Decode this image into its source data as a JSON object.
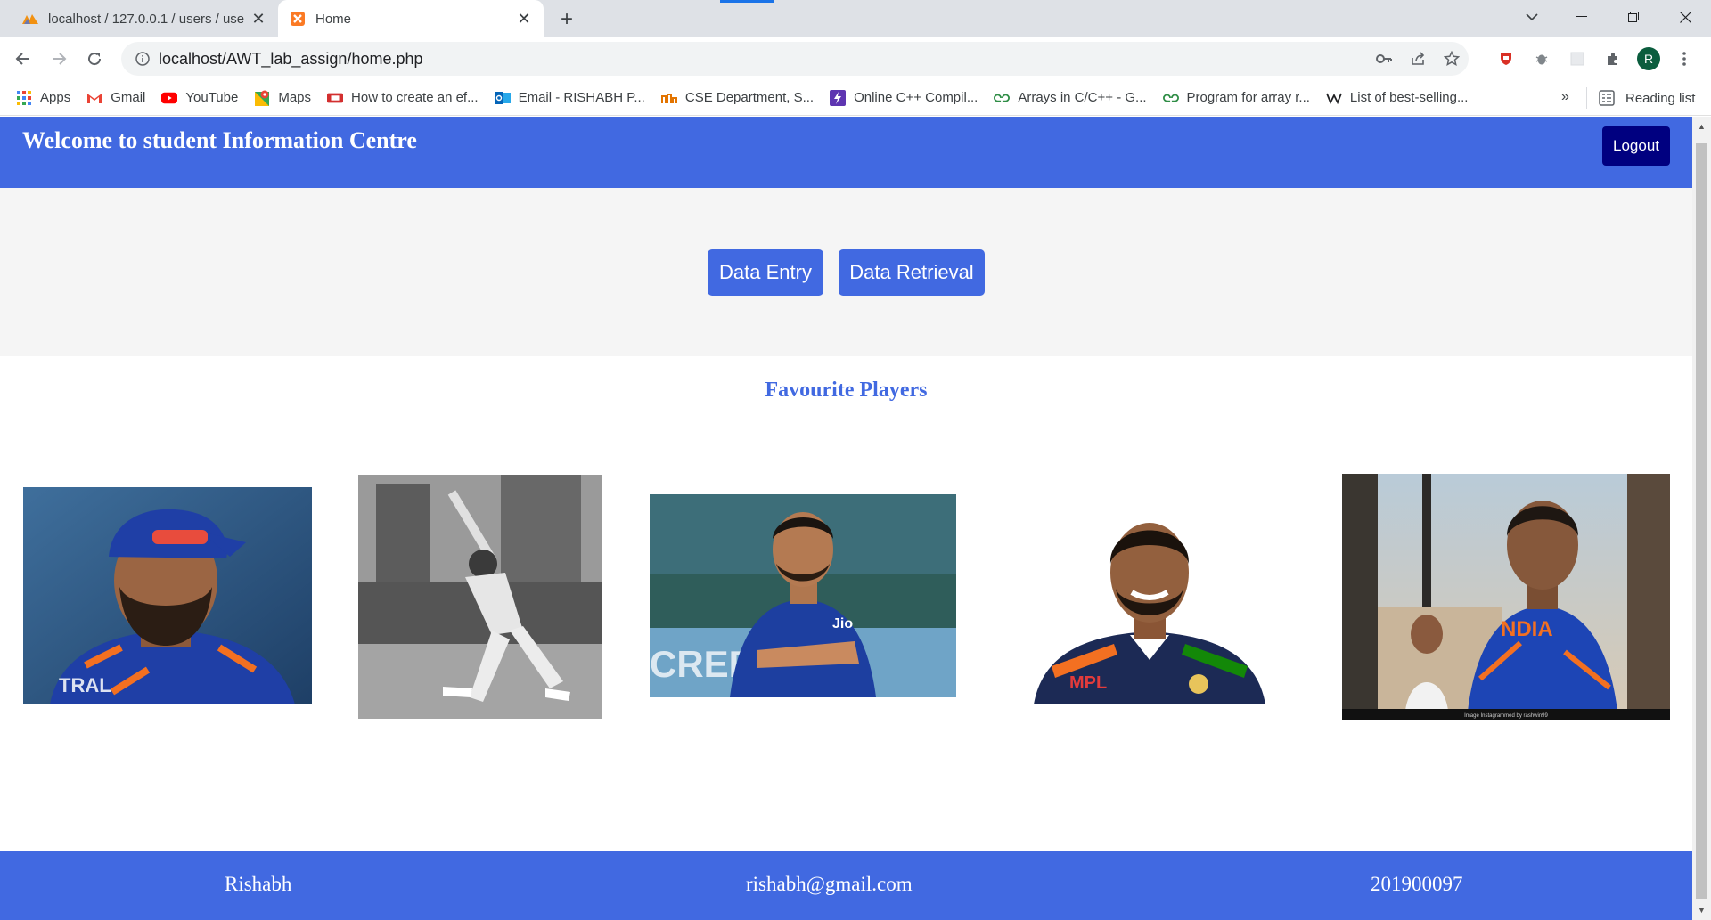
{
  "browser": {
    "tabs": [
      {
        "title": "localhost / 127.0.0.1 / users / use",
        "active": false,
        "icon": "phpmyadmin-icon"
      },
      {
        "title": "Home",
        "active": true,
        "icon": "xampp-icon"
      }
    ],
    "url": "localhost/AWT_lab_assign/home.php",
    "profile_initial": "R",
    "bookmarks": [
      {
        "label": "Apps",
        "icon": "apps-grid-icon"
      },
      {
        "label": "Gmail",
        "icon": "gmail-icon"
      },
      {
        "label": "YouTube",
        "icon": "youtube-icon"
      },
      {
        "label": "Maps",
        "icon": "maps-icon"
      },
      {
        "label": "How to create an ef...",
        "icon": "video-site-icon"
      },
      {
        "label": "Email - RISHABH P...",
        "icon": "outlook-icon"
      },
      {
        "label": "CSE Department, S...",
        "icon": "college-icon"
      },
      {
        "label": "Online C++ Compil...",
        "icon": "bolt-icon"
      },
      {
        "label": "Arrays in C/C++ - G...",
        "icon": "geeksforgeeks-icon"
      },
      {
        "label": "Program for array r...",
        "icon": "geeksforgeeks-icon"
      },
      {
        "label": "List of best-selling...",
        "icon": "wikipedia-icon"
      }
    ],
    "more": "»",
    "reading_list": "Reading list"
  },
  "site": {
    "title": "Welcome to student Information Centre",
    "logout": "Logout",
    "actions": {
      "entry": "Data Entry",
      "retrieval": "Data Retrieval"
    },
    "favourites_heading": "Favourite Players",
    "players": [
      {
        "image": "player-photo-1"
      },
      {
        "image": "player-photo-2"
      },
      {
        "image": "player-photo-3"
      },
      {
        "image": "player-photo-4"
      },
      {
        "image": "player-photo-5",
        "caption": "Image Instagrammed by rashwin99"
      }
    ],
    "footer": {
      "name": "Rishabh",
      "email": "rishabh@gmail.com",
      "id": "201900097"
    }
  },
  "colors": {
    "primary": "#4169e1",
    "logout": "#000080",
    "band": "#f5f5f5"
  }
}
